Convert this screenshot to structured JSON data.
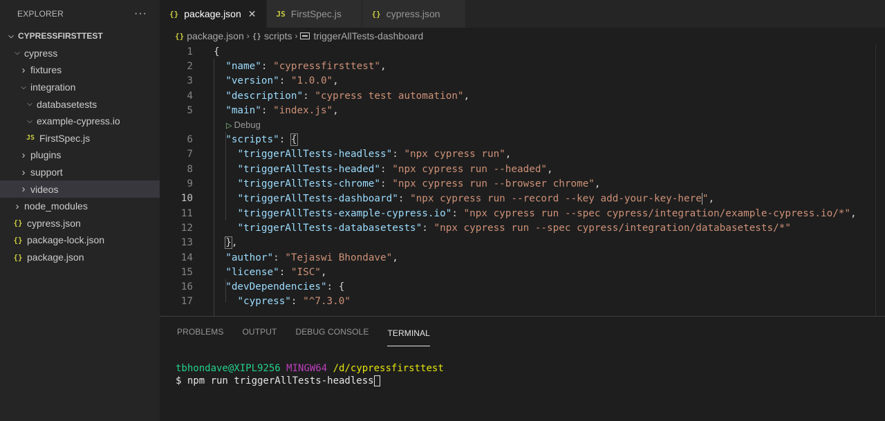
{
  "sidebar": {
    "title": "EXPLORER",
    "more": "···",
    "root": "CYPRESSFIRSTTEST",
    "items": [
      {
        "label": "cypress",
        "depth": 1,
        "kind": "folder-open"
      },
      {
        "label": "fixtures",
        "depth": 2,
        "kind": "folder-closed"
      },
      {
        "label": "integration",
        "depth": 2,
        "kind": "folder-open"
      },
      {
        "label": "databasetests",
        "depth": 3,
        "kind": "folder-open"
      },
      {
        "label": "example-cypress.io",
        "depth": 3,
        "kind": "folder-open"
      },
      {
        "label": "FirstSpec.js",
        "depth": 3,
        "kind": "js-file"
      },
      {
        "label": "plugins",
        "depth": 2,
        "kind": "folder-closed"
      },
      {
        "label": "support",
        "depth": 2,
        "kind": "folder-closed"
      },
      {
        "label": "videos",
        "depth": 2,
        "kind": "folder-closed",
        "selected": true
      },
      {
        "label": "node_modules",
        "depth": 1,
        "kind": "folder-closed"
      },
      {
        "label": "cypress.json",
        "depth": 1,
        "kind": "json-file"
      },
      {
        "label": "package-lock.json",
        "depth": 1,
        "kind": "json-file"
      },
      {
        "label": "package.json",
        "depth": 1,
        "kind": "json-file"
      }
    ]
  },
  "tabs": [
    {
      "label": "package.json",
      "icon": "{}",
      "active": true,
      "close": "✕"
    },
    {
      "label": "FirstSpec.js",
      "icon": "JS",
      "active": false
    },
    {
      "label": "cypress.json",
      "icon": "{}",
      "active": false
    }
  ],
  "breadcrumb": {
    "file": "package.json",
    "section": "scripts",
    "item": "triggerAllTests-dashboard",
    "section_icon": "{}",
    "file_icon": "{}"
  },
  "code": {
    "lens": "Debug",
    "lines": [
      {
        "n": "1",
        "indent": "",
        "tokens": [
          [
            "p",
            "{"
          ]
        ]
      },
      {
        "n": "2",
        "indent": "  ",
        "tokens": [
          [
            "k",
            "\"name\""
          ],
          [
            "p",
            ": "
          ],
          [
            "s",
            "\"cypressfirsttest\""
          ],
          [
            "p",
            ","
          ]
        ]
      },
      {
        "n": "3",
        "indent": "  ",
        "tokens": [
          [
            "k",
            "\"version\""
          ],
          [
            "p",
            ": "
          ],
          [
            "s",
            "\"1.0.0\""
          ],
          [
            "p",
            ","
          ]
        ]
      },
      {
        "n": "4",
        "indent": "  ",
        "tokens": [
          [
            "k",
            "\"description\""
          ],
          [
            "p",
            ": "
          ],
          [
            "s",
            "\"cypress test automation\""
          ],
          [
            "p",
            ","
          ]
        ]
      },
      {
        "n": "5",
        "indent": "  ",
        "tokens": [
          [
            "k",
            "\"main\""
          ],
          [
            "p",
            ": "
          ],
          [
            "s",
            "\"index.js\""
          ],
          [
            "p",
            ","
          ]
        ]
      },
      {
        "n": "6",
        "indent": "  ",
        "tokens": [
          [
            "k",
            "\"scripts\""
          ],
          [
            "p",
            ": "
          ],
          [
            "b",
            "{"
          ]
        ]
      },
      {
        "n": "7",
        "indent": "    ",
        "tokens": [
          [
            "k",
            "\"triggerAllTests-headless\""
          ],
          [
            "p",
            ": "
          ],
          [
            "s",
            "\"npx cypress run\""
          ],
          [
            "p",
            ","
          ]
        ]
      },
      {
        "n": "8",
        "indent": "    ",
        "tokens": [
          [
            "k",
            "\"triggerAllTests-headed\""
          ],
          [
            "p",
            ": "
          ],
          [
            "s",
            "\"npx cypress run --headed\""
          ],
          [
            "p",
            ","
          ]
        ]
      },
      {
        "n": "9",
        "indent": "    ",
        "tokens": [
          [
            "k",
            "\"triggerAllTests-chrome\""
          ],
          [
            "p",
            ": "
          ],
          [
            "s",
            "\"npx cypress run --browser chrome\""
          ],
          [
            "p",
            ","
          ]
        ]
      },
      {
        "n": "10",
        "indent": "    ",
        "current": true,
        "tokens": [
          [
            "k",
            "\"triggerAllTests-dashboard\""
          ],
          [
            "p",
            ": "
          ],
          [
            "s",
            "\"npx cypress run --record --key add-your-key-here"
          ],
          [
            "c",
            ""
          ],
          [
            "s",
            "\""
          ],
          [
            "p",
            ","
          ]
        ]
      },
      {
        "n": "11",
        "indent": "    ",
        "tokens": [
          [
            "k",
            "\"triggerAllTests-example-cypress.io\""
          ],
          [
            "p",
            ": "
          ],
          [
            "s",
            "\"npx cypress run --spec cypress/integration/example-cypress.io/*\""
          ],
          [
            "p",
            ","
          ]
        ]
      },
      {
        "n": "12",
        "indent": "    ",
        "tokens": [
          [
            "k",
            "\"triggerAllTests-databasetests\""
          ],
          [
            "p",
            ": "
          ],
          [
            "s",
            "\"npx cypress run --spec cypress/integration/databasetests/*\""
          ]
        ]
      },
      {
        "n": "13",
        "indent": "  ",
        "tokens": [
          [
            "b",
            "}"
          ],
          [
            "p",
            ","
          ]
        ]
      },
      {
        "n": "14",
        "indent": "  ",
        "tokens": [
          [
            "k",
            "\"author\""
          ],
          [
            "p",
            ": "
          ],
          [
            "s",
            "\"Tejaswi Bhondave\""
          ],
          [
            "p",
            ","
          ]
        ]
      },
      {
        "n": "15",
        "indent": "  ",
        "tokens": [
          [
            "k",
            "\"license\""
          ],
          [
            "p",
            ": "
          ],
          [
            "s",
            "\"ISC\""
          ],
          [
            "p",
            ","
          ]
        ]
      },
      {
        "n": "16",
        "indent": "  ",
        "tokens": [
          [
            "k",
            "\"devDependencies\""
          ],
          [
            "p",
            ": {"
          ]
        ]
      },
      {
        "n": "17",
        "indent": "    ",
        "tokens": [
          [
            "k",
            "\"cypress\""
          ],
          [
            "p",
            ": "
          ],
          [
            "s",
            "\"^7.3.0\""
          ]
        ]
      }
    ]
  },
  "panel": {
    "tabs": [
      "PROBLEMS",
      "OUTPUT",
      "DEBUG CONSOLE",
      "TERMINAL"
    ],
    "active_tab": "TERMINAL",
    "terminal": {
      "user": "tbhondave@XIPL9256",
      "shell": "MINGW64",
      "path": "/d/cypressfirsttest",
      "prompt": "$ ",
      "command": "npm run triggerAllTests-headless"
    }
  },
  "colors": {
    "key": "#9cdcfe",
    "string": "#ce9178",
    "json_icon": "#cbcb41",
    "term_user": "#23d18b",
    "term_shell": "#bc3fbc",
    "term_path": "#e5e510"
  }
}
